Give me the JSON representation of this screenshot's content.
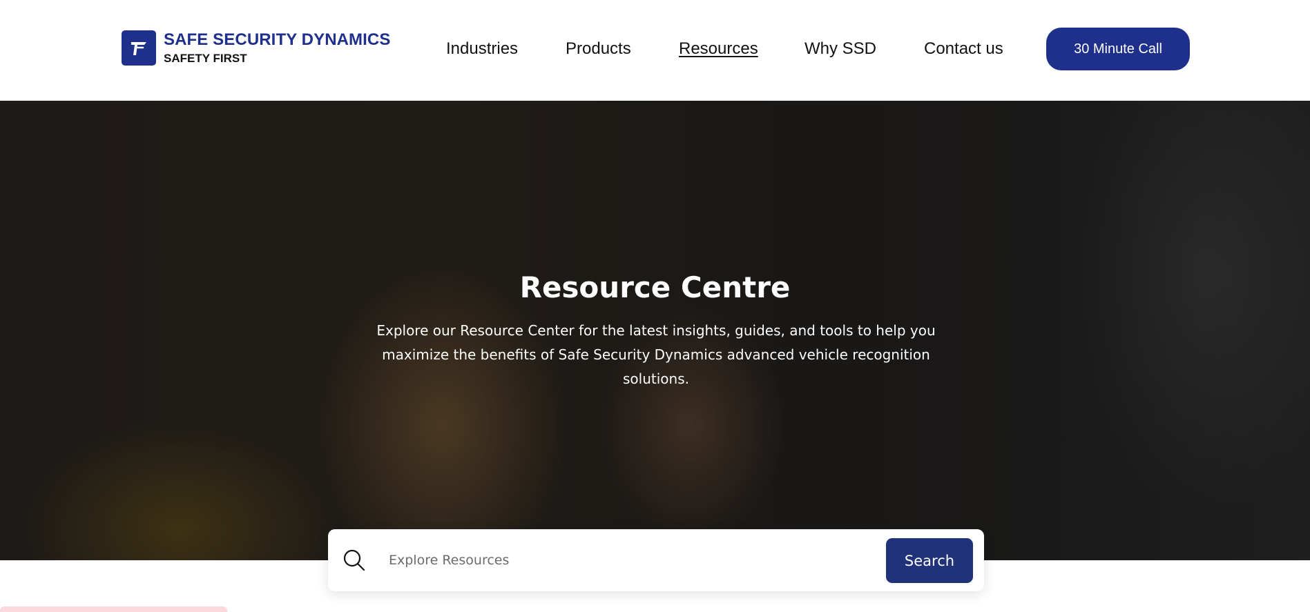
{
  "header": {
    "brand_name": "SAFE SECURITY DYNAMICS",
    "brand_tagline": "SAFETY FIRST",
    "logo_icon": "ssd-logo-icon",
    "nav": [
      {
        "label": "Industries",
        "active": false
      },
      {
        "label": "Products",
        "active": false
      },
      {
        "label": "Resources",
        "active": true
      },
      {
        "label": "Why SSD",
        "active": false
      },
      {
        "label": "Contact us",
        "active": false
      }
    ],
    "cta_label": "30 Minute Call"
  },
  "hero": {
    "title": "Resource Centre",
    "description": "Explore our Resource Center for the latest insights, guides, and tools to help you maximize the benefits of Safe Security Dynamics advanced vehicle recognition solutions."
  },
  "search": {
    "placeholder": "Explore Resources",
    "value": "",
    "button_label": "Search",
    "icon": "search-icon"
  },
  "colors": {
    "brand_blue": "#1e2f8c",
    "search_button": "#20337a",
    "pink_accent": "#fbd7de"
  }
}
